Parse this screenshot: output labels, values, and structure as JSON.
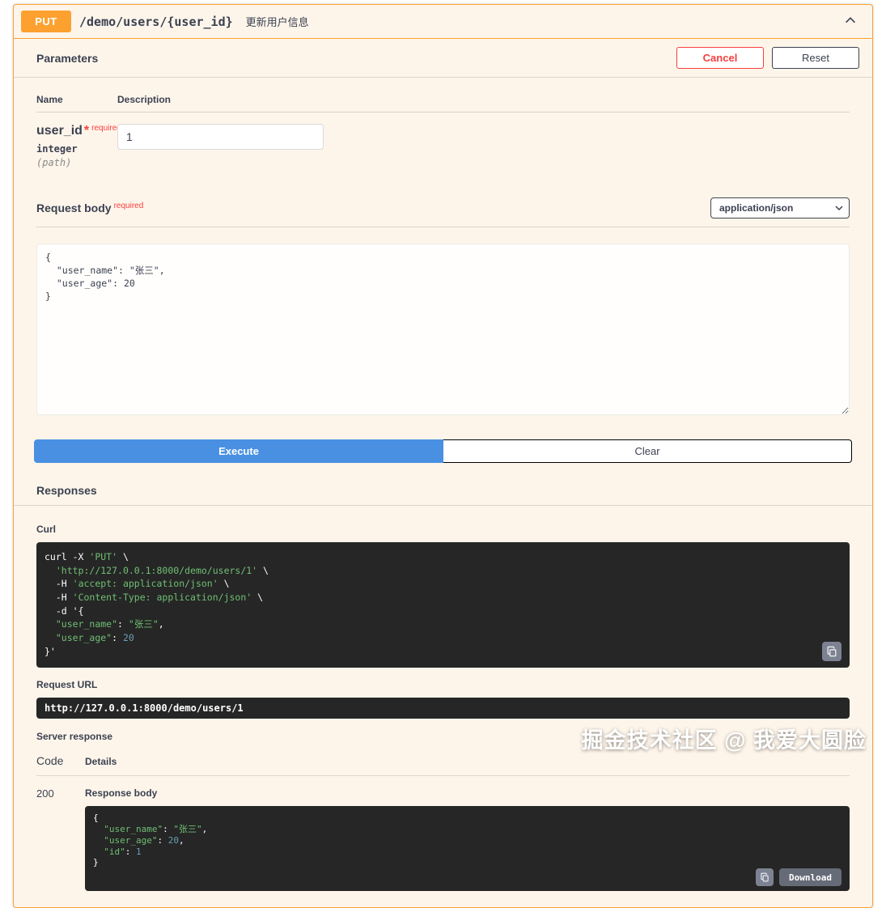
{
  "endpoint": {
    "method": "PUT",
    "path": "/demo/users/{user_id}",
    "summary": "更新用户信息"
  },
  "toolbar": {
    "tab_label": "Parameters",
    "cancel_label": "Cancel",
    "reset_label": "Reset"
  },
  "parameters": {
    "name_header": "Name",
    "description_header": "Description",
    "rows": [
      {
        "name": "user_id",
        "required_star": "*",
        "required_label": "required",
        "type": "integer",
        "location": "(path)",
        "value": "1"
      }
    ]
  },
  "request_body": {
    "label": "Request body",
    "required_label": "required",
    "content_type": "application/json",
    "value": "{\n  \"user_name\": \"张三\",\n  \"user_age\": 20\n}"
  },
  "execute": {
    "execute_label": "Execute",
    "clear_label": "Clear"
  },
  "responses": {
    "section_label": "Responses",
    "curl_label": "Curl",
    "curl_command": "curl -X 'PUT' \\\n  'http://127.0.0.1:8000/demo/users/1' \\\n  -H 'accept: application/json' \\\n  -H 'Content-Type: application/json' \\\n  -d '{\n  \"user_name\": \"张三\",\n  \"user_age\": 20\n}'",
    "request_url_label": "Request URL",
    "request_url": "http://127.0.0.1:8000/demo/users/1",
    "server_response_label": "Server response",
    "code_header": "Code",
    "details_header": "Details",
    "status_code": "200",
    "response_body_label": "Response body",
    "response_body": "{\n  \"user_name\": \"张三\",\n  \"user_age\": 20,\n  \"id\": 1\n}",
    "download_label": "Download"
  },
  "watermark": "掘金技术社区 @ 我爱大圆脸",
  "icons": {
    "collapse": "chevron-up-icon",
    "select_arrow": "chevron-down-icon",
    "copy": "copy-icon"
  },
  "colors": {
    "method": "#fca130",
    "execute": "#4990e2",
    "cancel": "#f93e3e",
    "code_bg": "#262626",
    "string_token": "#6fbf73",
    "number_token": "#6a9fb5"
  }
}
